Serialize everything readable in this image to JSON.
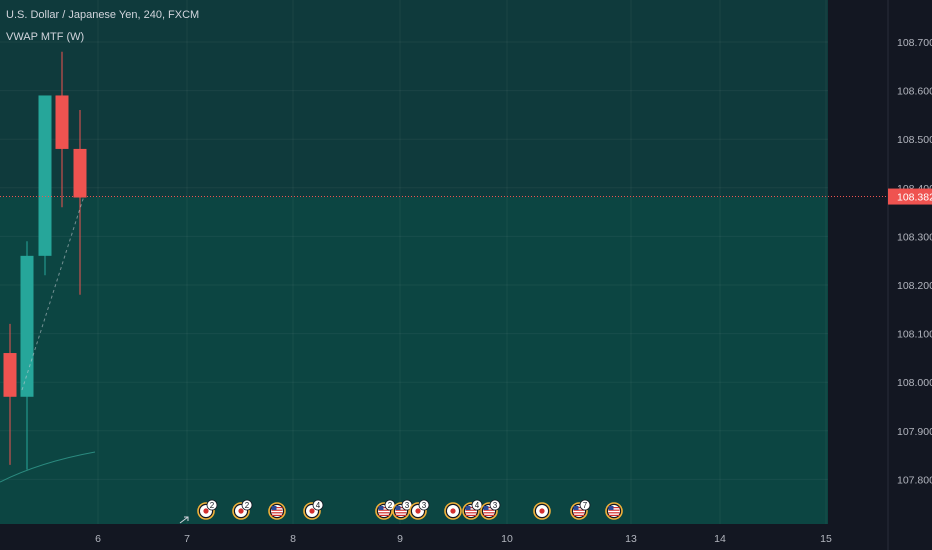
{
  "legend": {
    "symbol_line": "U.S. Dollar / Japanese Yen, 240, FXCM",
    "indicator": "VWAP MTF (W)"
  },
  "colors": {
    "background": "#131722",
    "up": "#26a69a",
    "down": "#ef5350",
    "zone_upper": "#0f3a3c",
    "zone_lower": "#0c4542",
    "price_line": "#ef5350",
    "axis_text": "#b2b5be"
  },
  "chart_data": {
    "type": "candlestick",
    "y_ticks": [
      "108.700",
      "108.600",
      "108.500",
      "108.400",
      "108.300",
      "108.200",
      "108.100",
      "108.000",
      "107.900",
      "107.800"
    ],
    "y_range": [
      107.72,
      108.76
    ],
    "x_ticks": [
      "6",
      "7",
      "8",
      "9",
      "10",
      "13",
      "14",
      "15"
    ],
    "current_price": "108.382",
    "candles": [
      {
        "open": 108.06,
        "high": 108.12,
        "low": 107.83,
        "close": 107.97
      },
      {
        "open": 107.97,
        "high": 108.29,
        "low": 107.82,
        "close": 108.26
      },
      {
        "open": 108.26,
        "high": 108.59,
        "low": 108.22,
        "close": 108.59
      },
      {
        "open": 108.59,
        "high": 108.68,
        "low": 108.36,
        "close": 108.48
      },
      {
        "open": 108.48,
        "high": 108.56,
        "low": 108.18,
        "close": 108.38
      }
    ],
    "zone": {
      "upper_top": 108.76,
      "split": 108.382
    },
    "events": [
      {
        "flag": "jp",
        "count": "2"
      },
      {
        "flag": "jp",
        "count": "2"
      },
      {
        "flag": "us",
        "count": ""
      },
      {
        "flag": "jp",
        "count": "4"
      },
      {
        "flag": "us",
        "count": "2"
      },
      {
        "flag": "us",
        "count": "3"
      },
      {
        "flag": "jp",
        "count": "3"
      },
      {
        "flag": "jp",
        "count": ""
      },
      {
        "flag": "us",
        "count": "4"
      },
      {
        "flag": "us",
        "count": "3"
      },
      {
        "flag": "jp",
        "count": ""
      },
      {
        "flag": "us",
        "count": "7"
      },
      {
        "flag": "us",
        "count": ""
      }
    ]
  }
}
